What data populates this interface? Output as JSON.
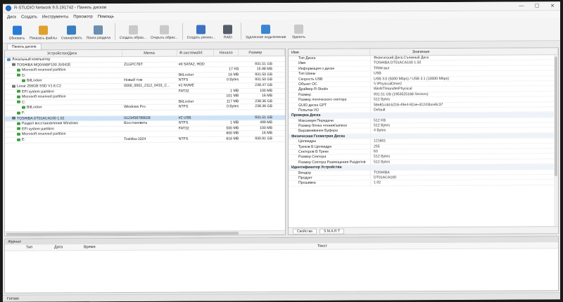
{
  "window": {
    "title": "R-STUDIO Network 9.5.191742 - Панель дисков",
    "minimize": "—",
    "maximize": "☐",
    "close": "✕"
  },
  "menu": [
    "Диск",
    "Создать",
    "Инструменты",
    "Просмотр",
    "Помощь"
  ],
  "toolbar": [
    {
      "label": "Обновить",
      "color": "#2a7ad6"
    },
    {
      "label": "Показать файлы",
      "color": "#e0a030"
    },
    {
      "label": "Сканировать",
      "color": "#3a7fbf"
    },
    {
      "label": "Поиск раздела",
      "color": "#6a8fb0"
    },
    {
      "label": "Создать образ...",
      "color": "#c9c9c9"
    },
    {
      "label": "Открыть образ...",
      "color": "#c9c9c9"
    },
    {
      "label": "Создать регион...",
      "color": "#3b73c0"
    },
    {
      "label": "RAID",
      "color": "#555d6b"
    },
    {
      "label": "Удаленное подключение",
      "color": "#3a86d0"
    },
    {
      "label": "Удалить",
      "color": "#c9c9c9"
    }
  ],
  "tab": "Панель дисков",
  "left": {
    "headers": {
      "device": "Устройство/Диск",
      "label": "Метка",
      "fs": "Ф.система/И:",
      "start": "Начало",
      "size": "Размер"
    },
    "rows": [
      {
        "ind": 0,
        "icon": "comp",
        "device": "Локальный компьютер",
        "label": "",
        "fs": "",
        "start": "",
        "size": ""
      },
      {
        "ind": 1,
        "icon": "hdd",
        "device": "TOSHIBA MQ04ABF100 JU042E",
        "label": "Z1GPC7BT",
        "fs": "#0 SATA2, HDD",
        "start": "",
        "size": "931.51 GB"
      },
      {
        "ind": 2,
        "icon": "part",
        "device": "Microsoft reserved partition",
        "label": "",
        "fs": "",
        "start": "17 KB",
        "size": "15.98 MB"
      },
      {
        "ind": 2,
        "icon": "part",
        "device": "D:",
        "label": "",
        "fs": "BitLocker",
        "start": "16 MB",
        "size": "931.50 GB"
      },
      {
        "ind": 3,
        "icon": "part",
        "device": "BitLocker",
        "label": "Новый том",
        "fs": "NTFS",
        "start": "0 Bytes",
        "size": "931.50 GB"
      },
      {
        "ind": 1,
        "icon": "ssd",
        "device": "Lexar 256GB SSD V1.6.C2",
        "label": "0000_0001_2112_0433_C...",
        "fs": "#1 NVME",
        "start": "",
        "size": "238.47 GB"
      },
      {
        "ind": 2,
        "icon": "part",
        "device": "EFI system partition",
        "label": "",
        "fs": "FAT32",
        "start": "1 MB",
        "size": "100 MB"
      },
      {
        "ind": 2,
        "icon": "part",
        "device": "Microsoft reserved partition",
        "label": "",
        "fs": "",
        "start": "101 MB",
        "size": "16 MB"
      },
      {
        "ind": 2,
        "icon": "part",
        "device": "C:",
        "label": "",
        "fs": "BitLocker",
        "start": "117 MB",
        "size": "238.36 GB"
      },
      {
        "ind": 3,
        "icon": "part",
        "device": "BitLocker",
        "label": "Windows Pro",
        "fs": "NTFS",
        "start": "0 Bytes",
        "size": "238.36 GB"
      },
      {
        "ind": 2,
        "icon": "part",
        "device": "F:",
        "label": "",
        "fs": "",
        "start": "",
        "size": ""
      },
      {
        "ind": 1,
        "icon": "hdd",
        "device": "TOSHIBA DT01ACA100 1.02",
        "label": "0123456789028",
        "fs": "#2 USB",
        "start": "",
        "size": "931.51 GB",
        "selected": true
      },
      {
        "ind": 2,
        "icon": "part",
        "device": "Раздел восстановления Windows",
        "label": "Восстановить",
        "fs": "NTFS",
        "start": "1 MB",
        "size": "499 MB"
      },
      {
        "ind": 2,
        "icon": "part",
        "device": "EFI system partition",
        "label": "",
        "fs": "FAT32",
        "start": "500 MB",
        "size": "100 MB"
      },
      {
        "ind": 2,
        "icon": "part",
        "device": "Microsoft reserved partition",
        "label": "",
        "fs": "",
        "start": "600 MB",
        "size": "16 MB"
      },
      {
        "ind": 2,
        "icon": "part",
        "device": "E:",
        "label": "Toshiba-1024",
        "fs": "NTFS",
        "start": "616 MB",
        "size": "930.91 GB"
      }
    ]
  },
  "right": {
    "headers": {
      "name": "Имя",
      "value": "Значение"
    },
    "rows": [
      {
        "k": "Тип Диска",
        "v": "Физический Диск,Съемный Диск"
      },
      {
        "k": "Имя",
        "v": "TOSHIBA DT01ACA100 1.02"
      },
      {
        "k": "Информация о диске",
        "v": "TRIM вкл"
      },
      {
        "k": "Тип Шины",
        "v": "USB"
      },
      {
        "k": "Скорость USB",
        "v": "USB 3.0 (5000 Mbps) / USB 3.1 (10000 Mbps)"
      },
      {
        "k": "Объект ОС",
        "v": "\\\\.\\PhysicalDrive2"
      },
      {
        "k": "Драйвер R-Studio",
        "v": "WinNT\\Handle\\Physical"
      },
      {
        "k": "Размер",
        "v": "931.51 GB (1953525168 Sectors)"
      },
      {
        "k": "Размер логического сектора",
        "v": "512 Bytes"
      },
      {
        "k": "GUID диска GPT",
        "v": "56e81cdd-b216-49e4-92ae-d1243bce6c37"
      },
      {
        "k": "Попытки I/O",
        "v": "Default"
      },
      {
        "group": true,
        "k": "Проверка Диска",
        "v": ""
      },
      {
        "k": "Максимум Передачи",
        "v": "512 KB"
      },
      {
        "k": "Размер блока чтения/записи",
        "v": "512 Bytes"
      },
      {
        "k": "Выравнивание Буфера",
        "v": "4 Bytes"
      },
      {
        "group": true,
        "k": "Физическая Геометрия Диска",
        "v": ""
      },
      {
        "k": "Цилиндры",
        "v": "121601"
      },
      {
        "k": "Треков В Цилиндре",
        "v": "255"
      },
      {
        "k": "Секторов В Треке",
        "v": "63"
      },
      {
        "k": "Размер Сектора",
        "v": "512 Bytes"
      },
      {
        "k": "Размер Сектора Размещения Разделов",
        "v": "512 Bytes"
      },
      {
        "group": true,
        "k": "Идентификатор Устройства",
        "v": ""
      },
      {
        "k": "Вендор",
        "v": "TOSHIBA"
      },
      {
        "k": "Продукт",
        "v": "DT01ACA100"
      },
      {
        "k": "Прошивка",
        "v": "1.02"
      }
    ],
    "tabs": [
      "Свойства",
      "S.M.A.R.T"
    ]
  },
  "journal": {
    "title": "Журнал",
    "headers": {
      "type": "Тип",
      "date": "Дата",
      "time": "Время",
      "text": "Текст"
    }
  },
  "status": "Готово"
}
